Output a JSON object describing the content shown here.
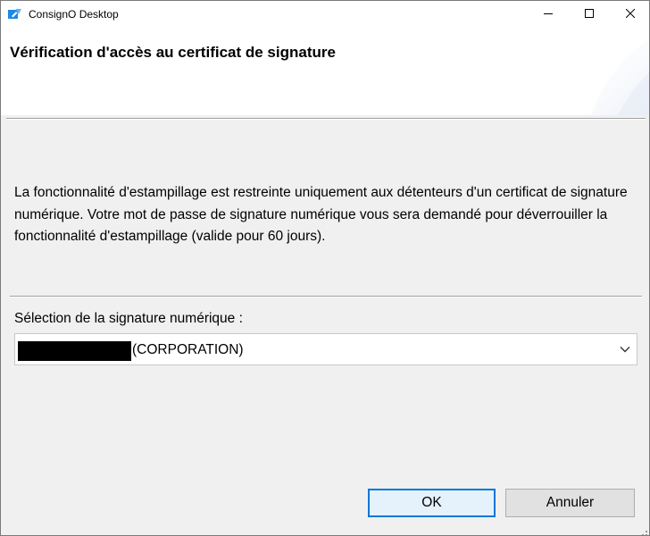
{
  "window": {
    "title": "ConsignO Desktop",
    "controls": {
      "minimize_icon": "minimize-icon",
      "maximize_icon": "maximize-icon",
      "close_icon": "close-icon"
    }
  },
  "header": {
    "title": "Vérification d'accès au certificat de signature"
  },
  "body": {
    "description": "La fonctionnalité d'estampillage est restreinte uniquement aux détenteurs d'un certificat de signature numérique. Votre mot de passe de signature numérique vous sera demandé pour déverrouiller la fonctionnalité d'estampillage (valide pour 60 jours).",
    "selection_label": "Sélection de la signature numérique :",
    "selected_signature_suffix": "(CORPORATION)"
  },
  "buttons": {
    "ok": "OK",
    "cancel": "Annuler"
  },
  "colors": {
    "accent": "#0078d7",
    "app_icon": "#1e88e5"
  }
}
